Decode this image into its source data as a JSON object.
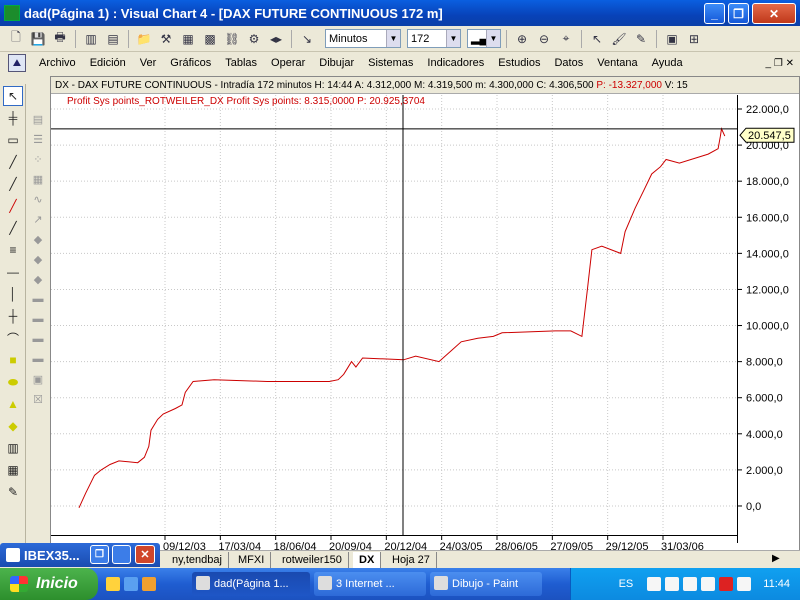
{
  "window": {
    "title": "dad(Página 1) : Visual Chart 4 - [DAX FUTURE CONTINUOUS 172 m]"
  },
  "toolbar": {
    "timeframe_value": "Minutos",
    "period_value": "172"
  },
  "menu": {
    "items": [
      "Archivo",
      "Edición",
      "Ver",
      "Gráficos",
      "Tablas",
      "Operar",
      "Dibujar",
      "Sistemas",
      "Indicadores",
      "Estudios",
      "Datos",
      "Ventana",
      "Ayuda"
    ]
  },
  "chart_header": {
    "info_text": "DX - DAX FUTURE CONTINUOUS - Intradía 172 minutos  H: 14:44  A: 4.312,000  M: 4.319,500  m: 4.300,000  C: 4.306,500",
    "change_text": "P: -13.327,000",
    "volume_text": "V: 15"
  },
  "legend": {
    "text": "Profit Sys points_ROTWEILER_DX  Profit Sys points: 8.315,0000  P: 20.925,3704"
  },
  "cursor_value": "20.547,5",
  "chart_data": {
    "type": "line",
    "title": "",
    "series": [
      {
        "name": "Profit Sys points_ROTWEILER_DX",
        "color": "#cc0000",
        "points": [
          [
            0,
            -100
          ],
          [
            0.6,
            700
          ],
          [
            1.4,
            1700
          ],
          [
            2.0,
            2000
          ],
          [
            2.8,
            2300
          ],
          [
            3.6,
            2500
          ],
          [
            5.3,
            2400
          ],
          [
            5.9,
            2700
          ],
          [
            6.3,
            3300
          ],
          [
            6.5,
            4200
          ],
          [
            7.1,
            4800
          ],
          [
            7.6,
            5100
          ],
          [
            8.7,
            5400
          ],
          [
            9.3,
            5600
          ],
          [
            9.6,
            6300
          ],
          [
            10.3,
            6900
          ],
          [
            12.2,
            7000
          ],
          [
            17,
            6900
          ],
          [
            22.6,
            6900
          ],
          [
            23.4,
            7000
          ],
          [
            23.9,
            7300
          ],
          [
            24.2,
            7600
          ],
          [
            24.6,
            8000
          ],
          [
            25.0,
            7700
          ],
          [
            25.6,
            8200
          ],
          [
            29.3,
            8100
          ],
          [
            30.4,
            8300
          ],
          [
            32.5,
            8000
          ],
          [
            33.6,
            8600
          ],
          [
            34.5,
            9100
          ],
          [
            36.0,
            9300
          ],
          [
            37.4,
            9400
          ],
          [
            38.2,
            9600
          ],
          [
            43.0,
            9700
          ],
          [
            44.4,
            9700
          ],
          [
            45.4,
            9400
          ],
          [
            45.9,
            12000
          ],
          [
            46.3,
            14200
          ],
          [
            47.2,
            14400
          ],
          [
            48.9,
            14000
          ],
          [
            49.3,
            15200
          ],
          [
            50.2,
            16500
          ],
          [
            51.0,
            17500
          ],
          [
            51.7,
            18400
          ],
          [
            52.5,
            18800
          ],
          [
            53.0,
            19200
          ],
          [
            54.2,
            19000
          ],
          [
            56.8,
            19500
          ],
          [
            57.7,
            19800
          ],
          [
            57.9,
            20500
          ],
          [
            58.0,
            20900
          ],
          [
            58.3,
            20500
          ]
        ]
      }
    ],
    "x_ticks": [
      "09/12/03",
      "17/03/04",
      "18/06/04",
      "20/09/04",
      "20/12/04",
      "24/03/05",
      "28/06/05",
      "27/09/05",
      "29/12/05",
      "31/03/06"
    ],
    "y_ticks": [
      "22.000,0",
      "20.000,0",
      "18.000,0",
      "16.000,0",
      "14.000,0",
      "12.000,0",
      "10.000,0",
      "8.000,0",
      "6.000,0",
      "4.000,0",
      "2.000,0",
      "0,0"
    ],
    "ylim": [
      -500,
      22000
    ],
    "grid": true
  },
  "tabs": [
    "ny,tendbaj",
    "MFXI",
    "rotweiler150",
    "DX",
    "Hoja 27"
  ],
  "float_window": {
    "title": "IBEX35..."
  },
  "taskbar": {
    "start_label": "Inicio",
    "tasks": [
      "dad(Página 1...",
      "3 Internet ...",
      "Dibujo - Paint"
    ],
    "language": "ES",
    "clock": "11:44"
  }
}
